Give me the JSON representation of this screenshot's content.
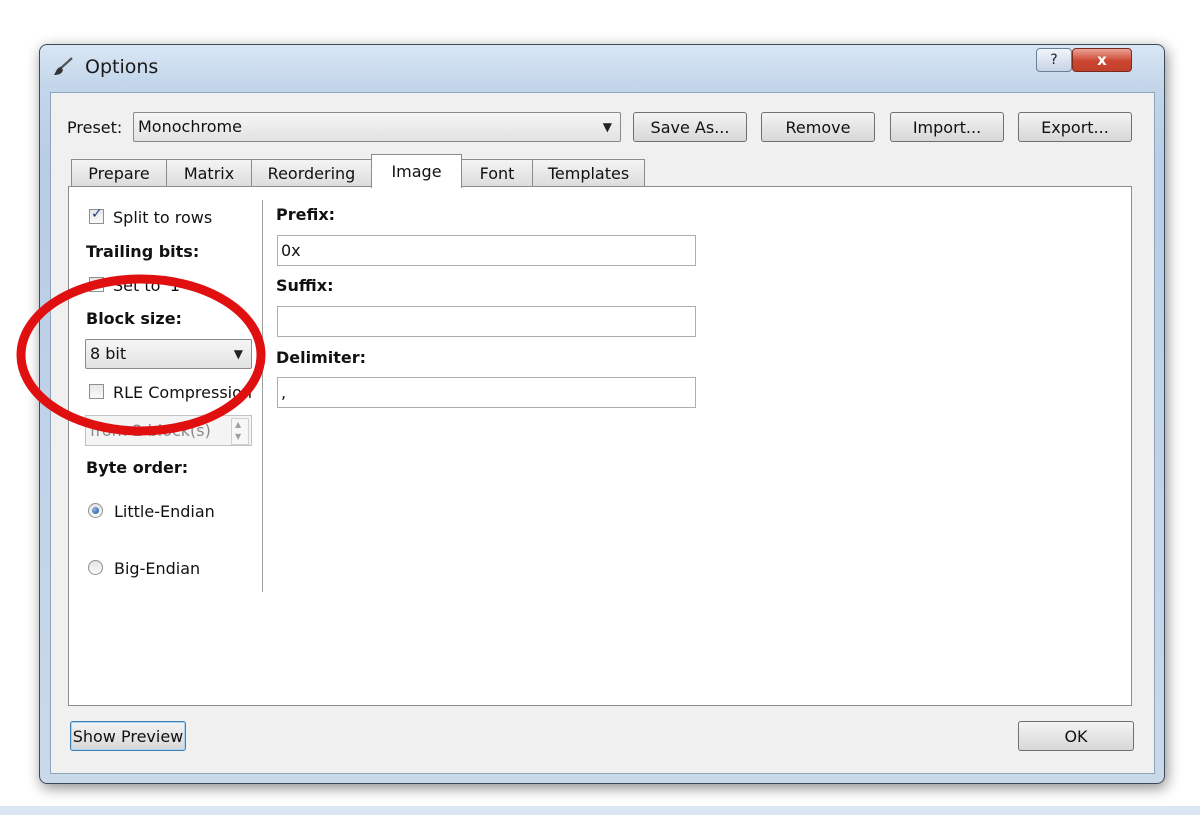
{
  "window": {
    "title": "Options",
    "help_label": "?",
    "close_label": "x"
  },
  "preset": {
    "label": "Preset:",
    "value": "Monochrome",
    "buttons": {
      "save_as": "Save As...",
      "remove": "Remove",
      "import": "Import...",
      "export": "Export..."
    }
  },
  "tabs": [
    "Prepare",
    "Matrix",
    "Reordering",
    "Image",
    "Font",
    "Templates"
  ],
  "active_tab": "Image",
  "image": {
    "split_to_rows": {
      "label": "Split to rows",
      "checked": true
    },
    "trailing_bits": {
      "heading": "Trailing bits:",
      "set_to_1": {
        "label": "Set to '1'",
        "checked": false
      }
    },
    "block_size": {
      "heading": "Block size:",
      "value": "8 bit"
    },
    "rle_compression": {
      "label": "RLE Compression",
      "checked": false
    },
    "rle_from": {
      "value": "from 2 block(s)"
    },
    "byte_order": {
      "heading": "Byte order:",
      "options": [
        "Little-Endian",
        "Big-Endian"
      ],
      "selected": "Little-Endian"
    },
    "prefix": {
      "label": "Prefix:",
      "value": "0x"
    },
    "suffix": {
      "label": "Suffix:",
      "value": ""
    },
    "delimiter": {
      "label": "Delimiter:",
      "value": ","
    }
  },
  "footer": {
    "show_preview": "Show Preview",
    "ok": "OK"
  },
  "colors": {
    "annotation_ellipse": "#e01010",
    "titlebar": "#c3d6ea",
    "close_button": "#c8432f"
  },
  "icons": {
    "app": "brush-icon",
    "dropdown": "chevron-down-icon"
  }
}
